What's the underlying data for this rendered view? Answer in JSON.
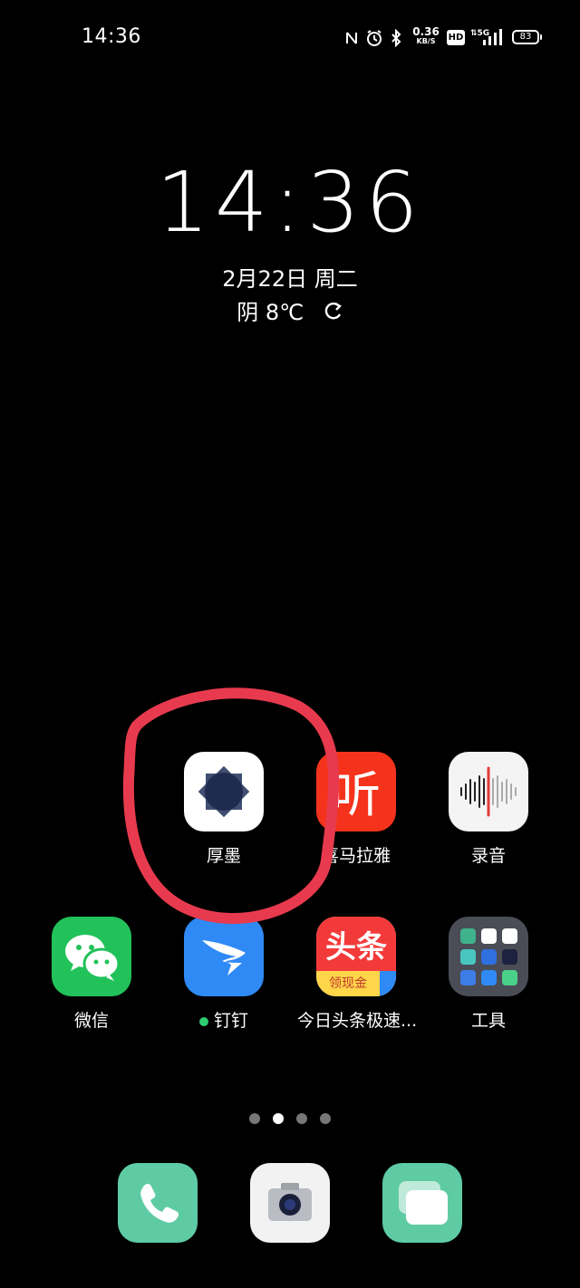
{
  "status_bar": {
    "time": "14:36",
    "net_speed_value": "0.36",
    "net_speed_unit": "KB/S",
    "hd_badge": "HD",
    "network_type": "5G",
    "battery": "83"
  },
  "clock_widget": {
    "time": "14:36",
    "date": "2月22日 周二",
    "weather": "阴 8℃"
  },
  "apps": [
    {
      "label": "厚墨",
      "icon": "houmo-app-icon"
    },
    {
      "label": "喜马拉雅",
      "icon": "ximalaya-app-icon"
    },
    {
      "label": "录音",
      "icon": "recorder-app-icon"
    },
    {
      "label": "微信",
      "icon": "wechat-app-icon"
    },
    {
      "label": "钉钉",
      "icon": "dingtalk-app-icon"
    },
    {
      "label": "今日头条极速...",
      "icon": "toutiao-app-icon",
      "tile_text": "头条",
      "tile_subtext": "领现金"
    },
    {
      "label": "工具",
      "icon": "tools-folder-icon"
    }
  ],
  "pager": {
    "pages": 4,
    "active": 2
  },
  "dock": [
    "phone-icon",
    "camera-icon",
    "messages-icon"
  ],
  "colors": {
    "annotation_red": "#e83a4e",
    "wechat_green": "#21c25a",
    "dingtalk_blue": "#2f8af5",
    "ximalaya_red": "#f5331c",
    "dock_mint": "#5fcba4"
  }
}
